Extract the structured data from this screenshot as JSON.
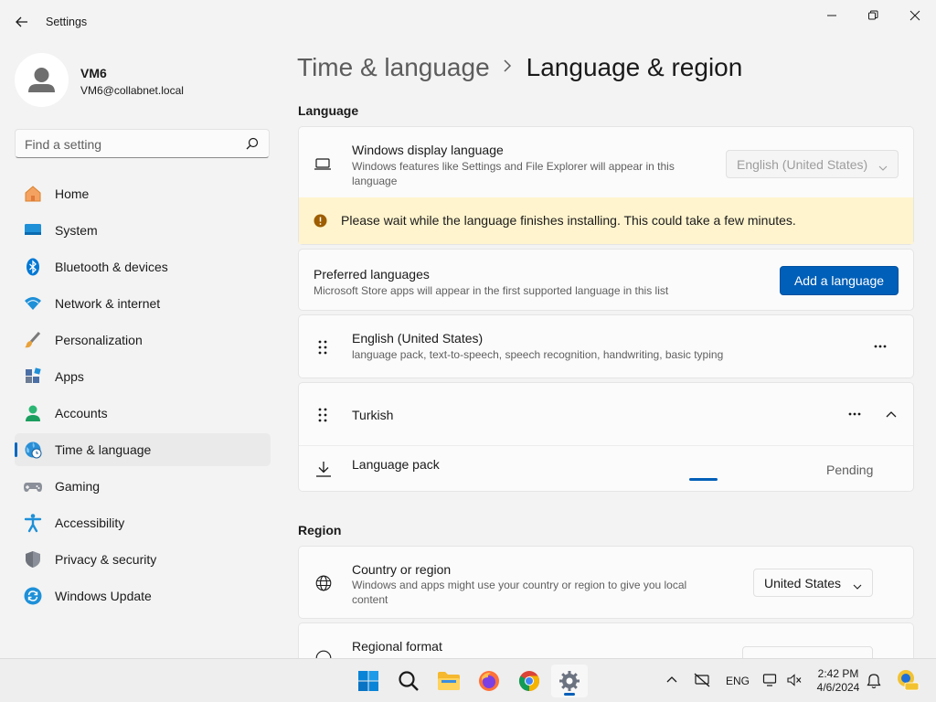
{
  "window": {
    "title": "Settings"
  },
  "profile": {
    "name": "VM6",
    "email": "VM6@collabnet.local"
  },
  "search": {
    "placeholder": "Find a setting"
  },
  "sidebar": {
    "items": [
      {
        "label": "Home",
        "icon": "home-icon"
      },
      {
        "label": "System",
        "icon": "system-icon"
      },
      {
        "label": "Bluetooth & devices",
        "icon": "bluetooth-icon"
      },
      {
        "label": "Network & internet",
        "icon": "wifi-icon"
      },
      {
        "label": "Personalization",
        "icon": "brush-icon"
      },
      {
        "label": "Apps",
        "icon": "apps-icon"
      },
      {
        "label": "Accounts",
        "icon": "accounts-icon"
      },
      {
        "label": "Time & language",
        "icon": "globe-clock-icon",
        "active": true
      },
      {
        "label": "Gaming",
        "icon": "gamepad-icon"
      },
      {
        "label": "Accessibility",
        "icon": "accessibility-icon"
      },
      {
        "label": "Privacy & security",
        "icon": "shield-icon"
      },
      {
        "label": "Windows Update",
        "icon": "update-icon"
      }
    ]
  },
  "breadcrumb": {
    "parent": "Time & language",
    "separator": ">",
    "current": "Language & region"
  },
  "language": {
    "section_title": "Language",
    "display_language": {
      "title": "Windows display language",
      "subtitle": "Windows features like Settings and File Explorer will appear in this language",
      "value": "English (United States)"
    },
    "warning": "Please wait while the language finishes installing. This could take a few minutes.",
    "preferred": {
      "title": "Preferred languages",
      "subtitle": "Microsoft Store apps will appear in the first supported language in this list",
      "button": "Add a language"
    },
    "languages": [
      {
        "name": "English (United States)",
        "detail": "language pack, text-to-speech, speech recognition, handwriting, basic typing"
      },
      {
        "name": "Turkish",
        "detail": ""
      }
    ],
    "language_pack": {
      "title": "Language pack",
      "status": "Pending"
    }
  },
  "region": {
    "section_title": "Region",
    "country": {
      "title": "Country or region",
      "subtitle": "Windows and apps might use your country or region to give you local content",
      "value": "United States"
    },
    "format": {
      "title": "Regional format"
    }
  },
  "taskbar": {
    "language": "ENG",
    "time": "2:42 PM",
    "date": "4/6/2024"
  },
  "colors": {
    "accent": "#005fb8",
    "warning_bg": "#fff4ce",
    "warning_icon": "#9d5d00"
  }
}
